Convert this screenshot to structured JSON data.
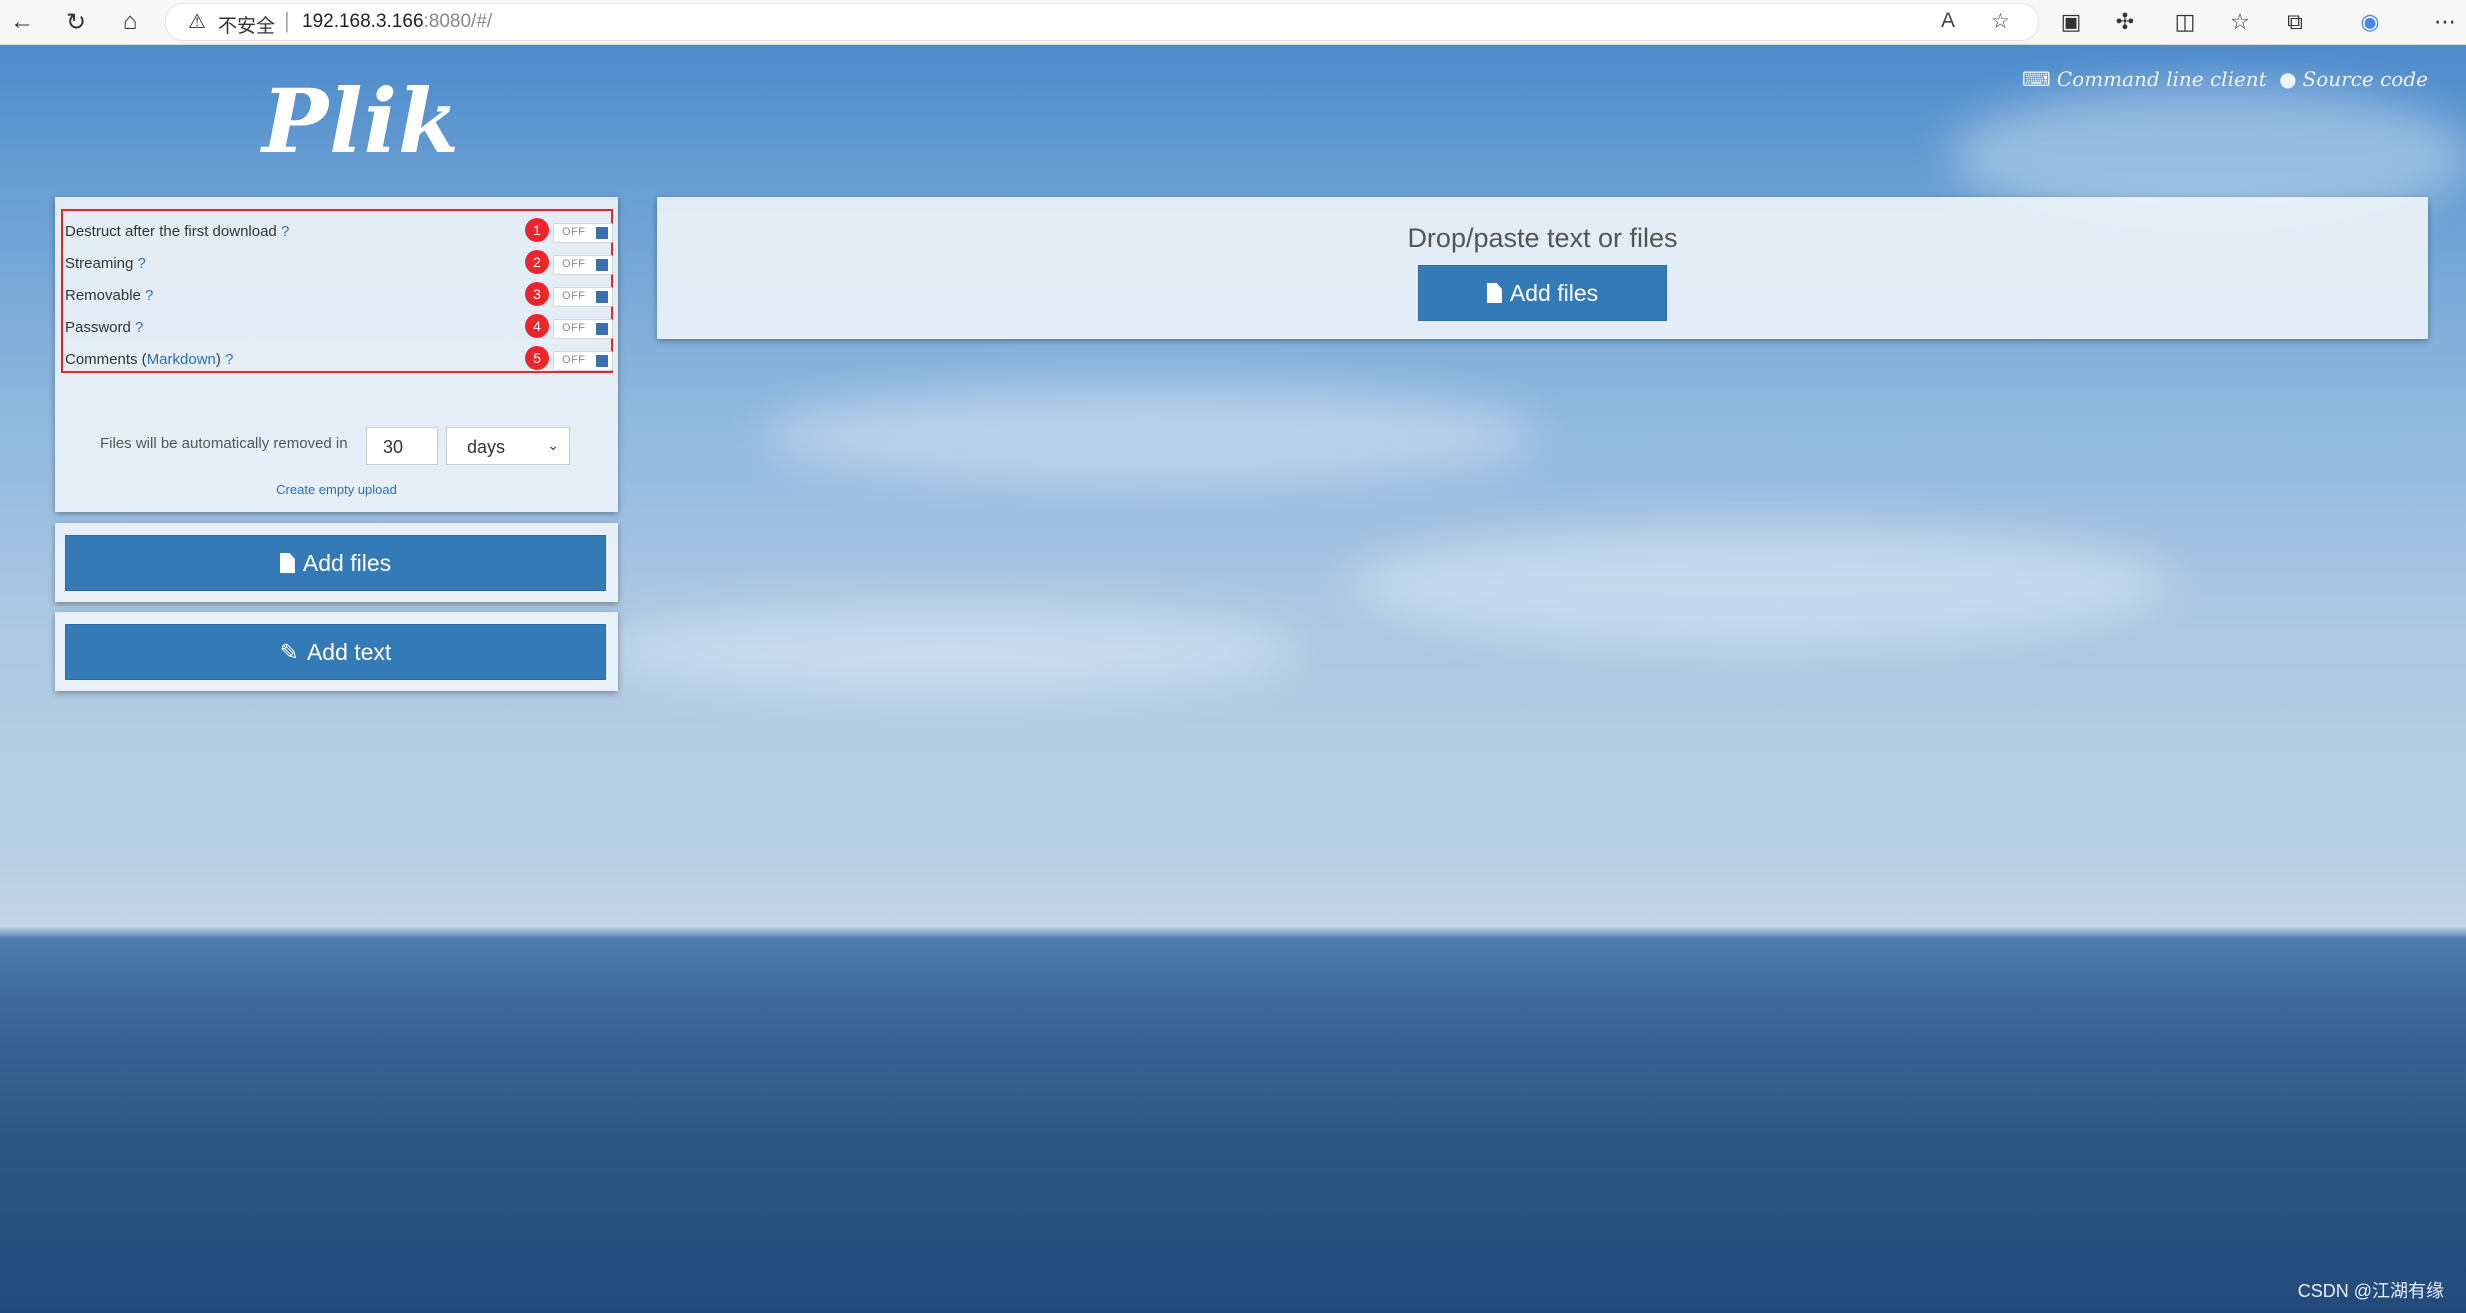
{
  "browser": {
    "insecure_label": "不安全",
    "url_host": "192.168.3.166",
    "url_rest": ":8080/#/"
  },
  "page": {
    "logo": "Plik",
    "links": {
      "cli": "Command line client",
      "source": "Source code"
    }
  },
  "settings": {
    "options": [
      {
        "label": "Destruct after the first download",
        "help": "?",
        "badge": "1",
        "state": "OFF"
      },
      {
        "label": "Streaming",
        "help": "?",
        "badge": "2",
        "state": "OFF"
      },
      {
        "label": "Removable",
        "help": "?",
        "badge": "3",
        "state": "OFF"
      },
      {
        "label": "Password",
        "help": "?",
        "badge": "4",
        "state": "OFF"
      },
      {
        "label_prefix": "Comments (",
        "link": "Markdown",
        "label_suffix": ")",
        "help": "?",
        "badge": "5",
        "state": "OFF"
      }
    ],
    "ttl_text": "Files will be automatically removed in",
    "ttl_value": "30",
    "ttl_unit": "days",
    "empty_upload": "Create empty upload"
  },
  "buttons": {
    "add_files": "Add files",
    "add_text": "Add text"
  },
  "drop": {
    "title": "Drop/paste text or files",
    "button": "Add files"
  },
  "watermark": "CSDN @江湖有缘",
  "colors": {
    "primary_button": "#337ab7",
    "badge": "#e8262b",
    "annotation_box": "#e02a2a"
  }
}
